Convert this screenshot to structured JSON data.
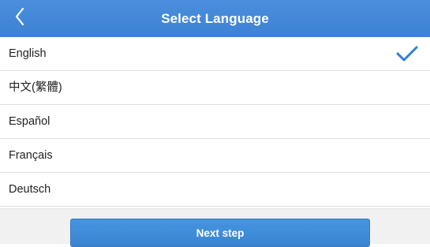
{
  "header": {
    "title": "Select Language",
    "back_icon": "chevron-left-icon",
    "background_color": "#3f86d6"
  },
  "languages": [
    {
      "label": "English",
      "selected": true
    },
    {
      "label": "中文(繁體)",
      "selected": false
    },
    {
      "label": "Español",
      "selected": false
    },
    {
      "label": "Français",
      "selected": false
    },
    {
      "label": "Deutsch",
      "selected": false
    }
  ],
  "selected_icon": "checkmark-icon",
  "accent_color": "#2f7fd3",
  "footer": {
    "next_label": "Next step"
  }
}
